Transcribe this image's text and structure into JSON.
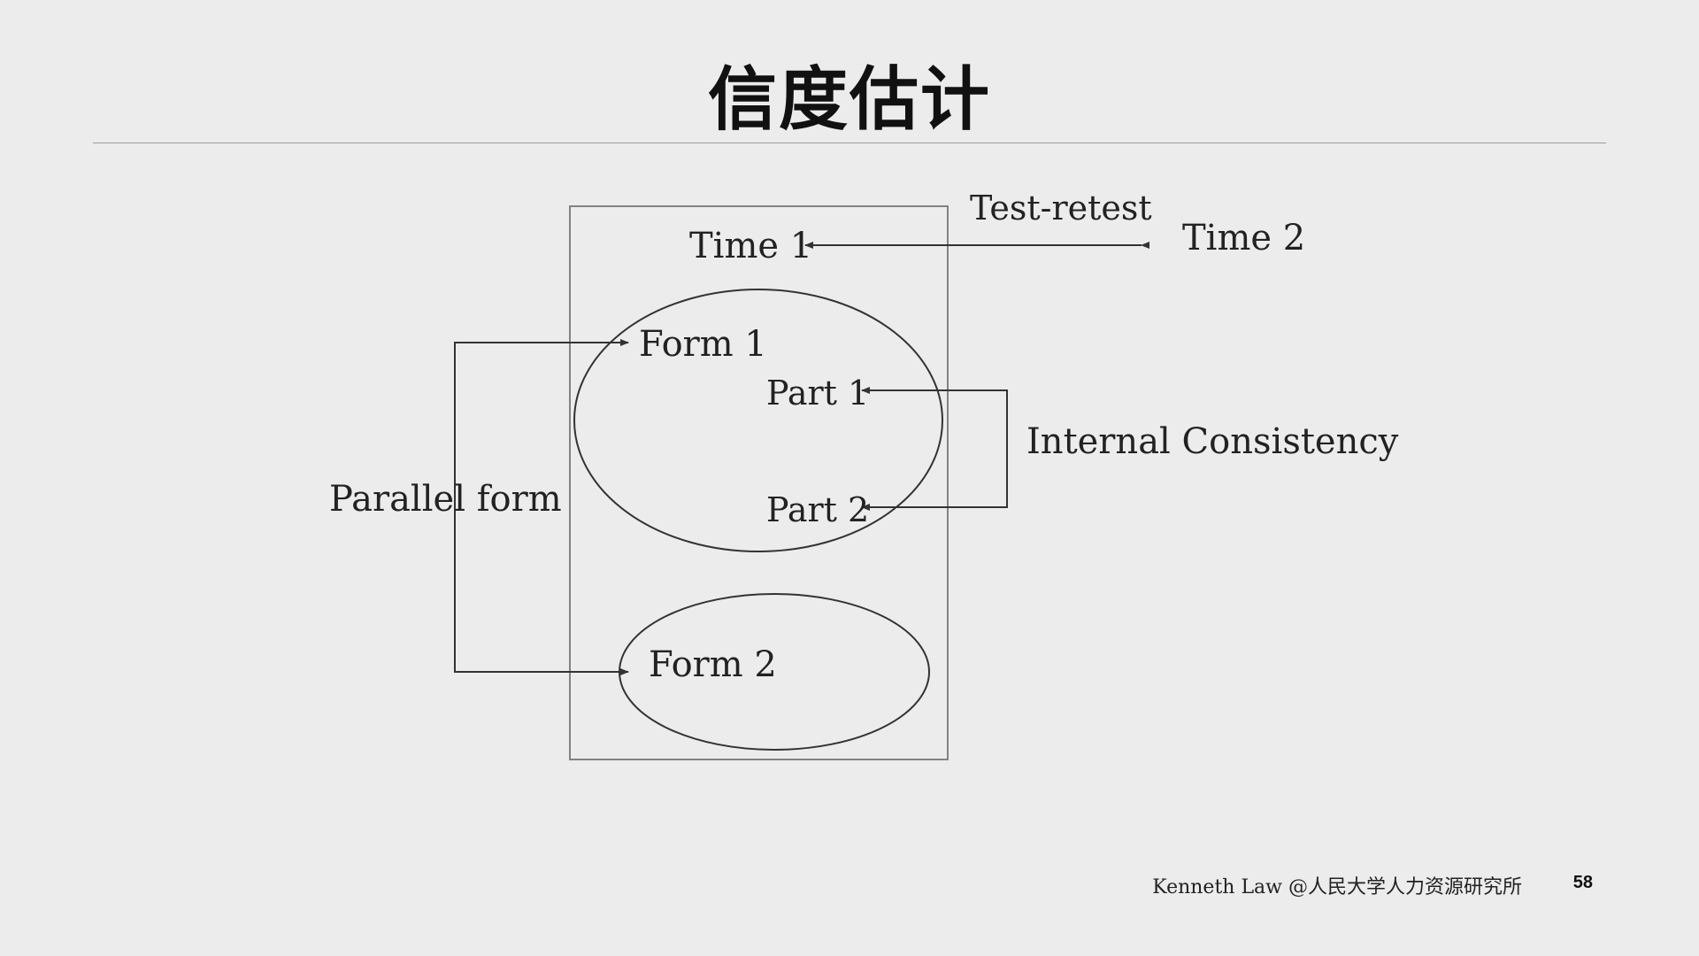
{
  "slide": {
    "title": "信度估计",
    "footer": "Kenneth Law @人民大学人力资源研究所",
    "page_number": "58"
  },
  "diagram": {
    "labels": {
      "test_retest": "Test-retest",
      "time1": "Time 1",
      "time2": "Time 2",
      "form1": "Form 1",
      "form2": "Form 2",
      "part1": "Part 1",
      "part2": "Part 2",
      "internal_consistency": "Internal Consistency",
      "parallel_form": "Parallel form"
    },
    "colors": {
      "background": "#ececec",
      "line": "#333333",
      "text": "#222222"
    }
  }
}
